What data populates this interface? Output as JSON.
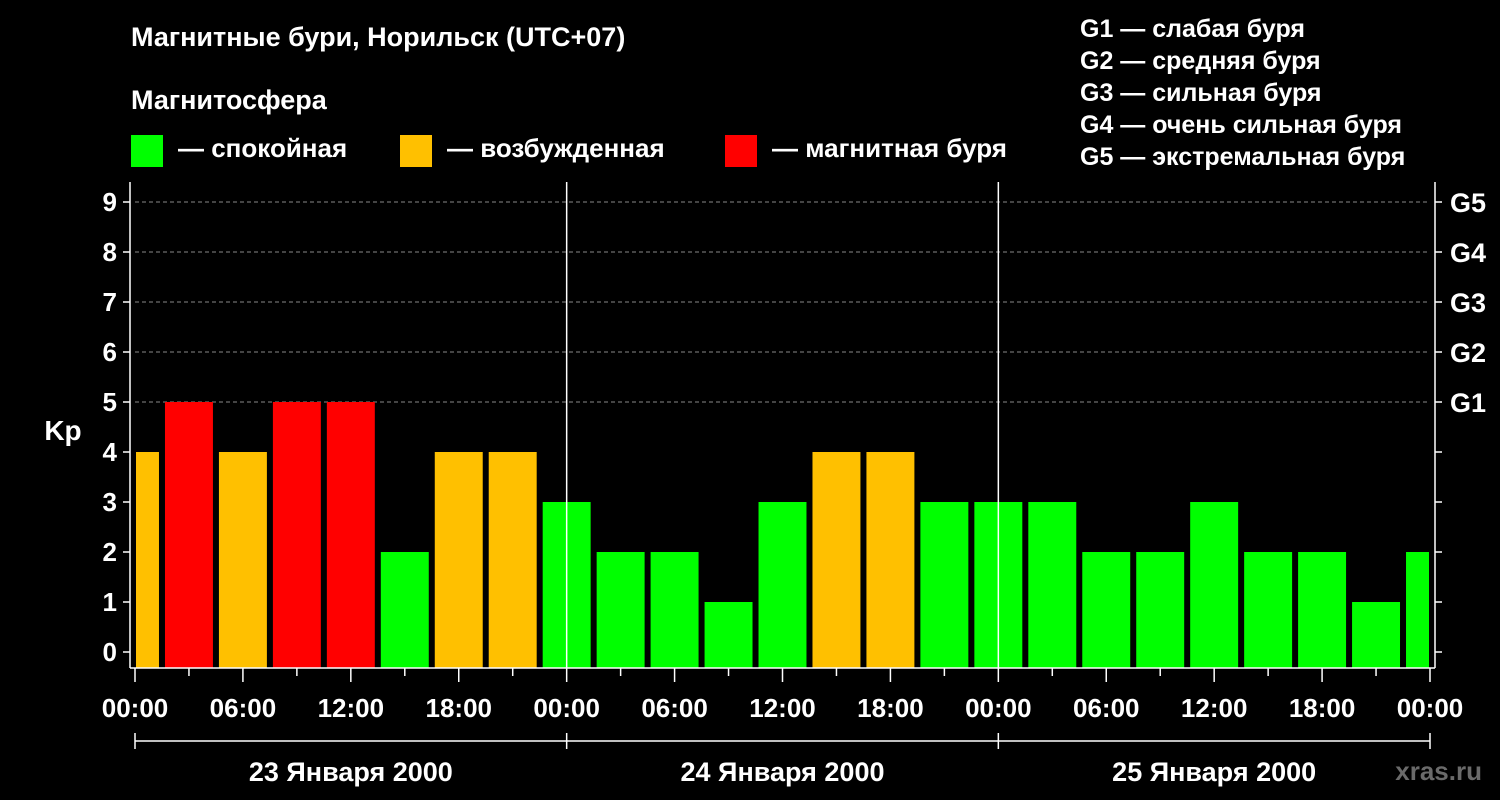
{
  "chart_data": {
    "type": "bar",
    "title": "Магнитные бури, Норильск (UTC+07)",
    "ylabel": "Kp",
    "ylim": [
      0,
      9
    ],
    "yticks": [
      "0",
      "1",
      "2",
      "3",
      "4",
      "5",
      "6",
      "7",
      "8",
      "9"
    ],
    "right_axis_labels": [
      {
        "kp": 5,
        "label": "G1"
      },
      {
        "kp": 6,
        "label": "G2"
      },
      {
        "kp": 7,
        "label": "G3"
      },
      {
        "kp": 8,
        "label": "G4"
      },
      {
        "kp": 9,
        "label": "G5"
      }
    ],
    "x_tick_labels": [
      "00:00",
      "06:00",
      "12:00",
      "18:00",
      "00:00",
      "06:00",
      "12:00",
      "18:00",
      "00:00",
      "06:00",
      "12:00",
      "18:00",
      "00:00"
    ],
    "days": [
      "23 Января 2000",
      "24 Января 2000",
      "25 Января 2000"
    ],
    "interval_hours": 3,
    "values": [
      4,
      5,
      4,
      5,
      5,
      2,
      4,
      4,
      3,
      2,
      2,
      1,
      3,
      4,
      4,
      3,
      3,
      3,
      2,
      2,
      3,
      2,
      2,
      1,
      2
    ],
    "grid": "dashed horizontal at Kp 5–9",
    "legend": {
      "heading": "Магнитосфера",
      "items": [
        {
          "label": "— спокойная",
          "color": "#00ff00"
        },
        {
          "label": "— возбужденная",
          "color": "#ffc000"
        },
        {
          "label": "— магнитная буря",
          "color": "#ff0000"
        }
      ]
    },
    "storm_scale": [
      "G1 — слабая буря",
      "G2 — средняя буря",
      "G3 — сильная буря",
      "G4 — очень сильная буря",
      "G5 — экстремальная буря"
    ],
    "colors": {
      "quiet": "#00ff00",
      "active": "#ffc000",
      "storm": "#ff0000"
    }
  },
  "watermark": "xras.ru"
}
